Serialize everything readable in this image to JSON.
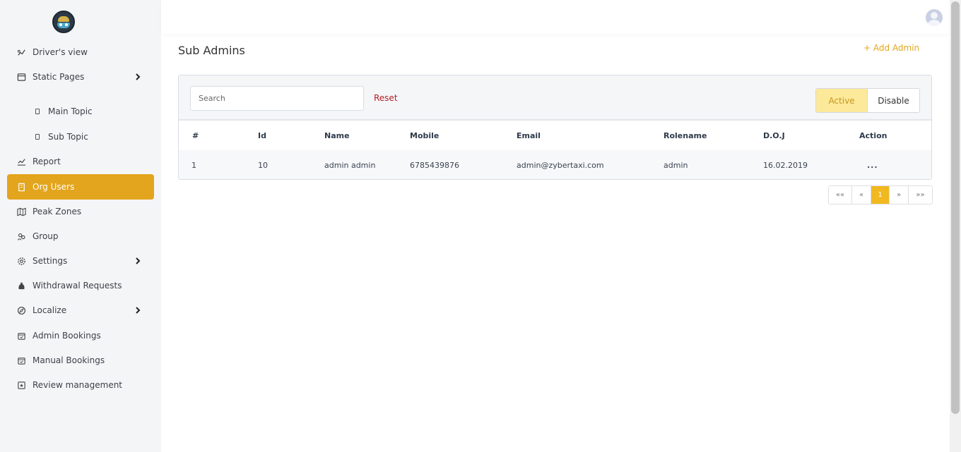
{
  "sidebar": {
    "items": [
      {
        "label": "Driver's view"
      },
      {
        "label": "Static Pages"
      },
      {
        "label": "Main Topic"
      },
      {
        "label": "Sub Topic"
      },
      {
        "label": "Report"
      },
      {
        "label": "Org Users"
      },
      {
        "label": "Peak Zones"
      },
      {
        "label": "Group"
      },
      {
        "label": "Settings"
      },
      {
        "label": "Withdrawal Requests"
      },
      {
        "label": "Localize"
      },
      {
        "label": "Admin Bookings"
      },
      {
        "label": "Manual Bookings"
      },
      {
        "label": "Review management"
      }
    ],
    "active": "Org Users"
  },
  "page": {
    "title": "Sub Admins",
    "add_button": "+ Add Admin"
  },
  "toolbar": {
    "search_placeholder": "Search",
    "reset_label": "Reset",
    "active_label": "Active",
    "disable_label": "Disable"
  },
  "table": {
    "headers": [
      "#",
      "Id",
      "Name",
      "Mobile",
      "Email",
      "Rolename",
      "D.O.J",
      "Action"
    ],
    "rows": [
      [
        "1",
        "10",
        "admin admin",
        "6785439876",
        "admin@zybertaxi.com",
        "admin",
        "16.02.2019",
        "..."
      ]
    ]
  },
  "pagination": {
    "first": "««",
    "prev": "«",
    "current": "1",
    "next": "»",
    "last": "»»"
  },
  "colors": {
    "accent": "#e3a51e",
    "reset": "#b21f24",
    "active_toggle_bg": "#fde99a"
  }
}
